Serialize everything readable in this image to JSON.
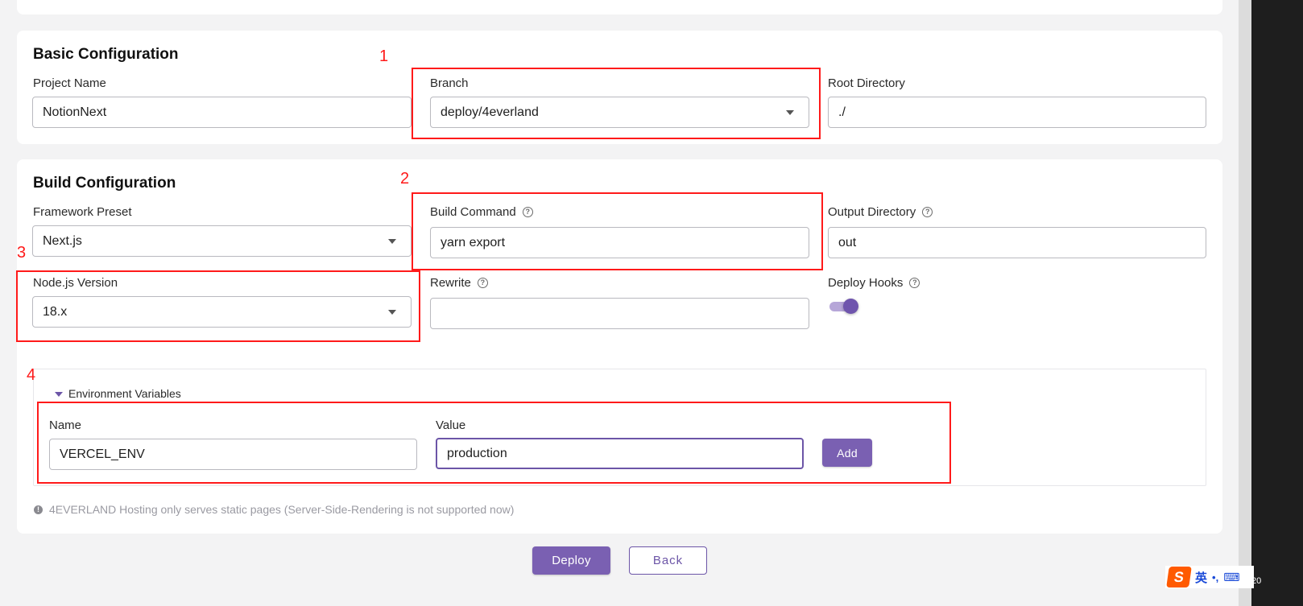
{
  "basic": {
    "title": "Basic Configuration",
    "project_name_label": "Project Name",
    "project_name_value": "NotionNext",
    "branch_label": "Branch",
    "branch_value": "deploy/4everland",
    "root_dir_label": "Root Directory",
    "root_dir_value": "./"
  },
  "build": {
    "title": "Build Configuration",
    "framework_label": "Framework Preset",
    "framework_value": "Next.js",
    "build_command_label": "Build Command",
    "build_command_value": "yarn export",
    "output_dir_label": "Output Directory",
    "output_dir_value": "out",
    "node_label": "Node.js Version",
    "node_value": "18.x",
    "rewrite_label": "Rewrite",
    "rewrite_value": "",
    "deploy_hooks_label": "Deploy Hooks",
    "deploy_hooks_on": true
  },
  "env": {
    "header": "Environment Variables",
    "name_label": "Name",
    "name_value": "VERCEL_ENV",
    "value_label": "Value",
    "value_value": "production",
    "add_label": "Add"
  },
  "note": "4EVERLAND Hosting only serves static pages (Server-Side-Rendering is not supported now)",
  "actions": {
    "deploy_label": "Deploy",
    "back_label": "Back"
  },
  "annotations": [
    "1",
    "2",
    "3",
    "4"
  ],
  "taskbar": {
    "ime_logo": "S",
    "ime_lang": "英",
    "ime_punct": "•,",
    "ime_keyboard": "⌨",
    "clock_fragment": "20"
  },
  "colors": {
    "accent": "#7a60b2",
    "annotation": "#ff1a1a",
    "background": "#f3f3f4",
    "ime_logo": "#ff5a00"
  },
  "icons": {
    "help": "question-circle-icon",
    "dropdown": "chevron-down-icon",
    "info": "info-circle-icon",
    "expand": "caret-down-icon"
  }
}
